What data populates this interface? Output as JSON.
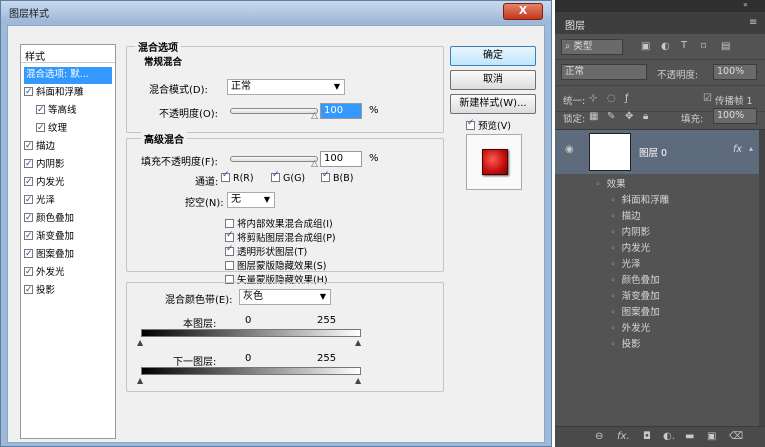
{
  "dialog": {
    "title": "图层样式",
    "close_label": "X"
  },
  "styles": {
    "header": "样式",
    "selected": "混合选项: 默...",
    "items": [
      {
        "label": "斜面和浮雕",
        "checked": true
      },
      {
        "label": "等高线",
        "checked": true
      },
      {
        "label": "纹理",
        "checked": true
      },
      {
        "label": "描边",
        "checked": true
      },
      {
        "label": "内阴影",
        "checked": true
      },
      {
        "label": "内发光",
        "checked": true
      },
      {
        "label": "光泽",
        "checked": true
      },
      {
        "label": "颜色叠加",
        "checked": true
      },
      {
        "label": "渐变叠加",
        "checked": true
      },
      {
        "label": "图案叠加",
        "checked": true
      },
      {
        "label": "外发光",
        "checked": true
      },
      {
        "label": "投影",
        "checked": true
      }
    ]
  },
  "blend": {
    "group_title": "混合选项",
    "general_title": "常规混合",
    "mode_label": "混合模式(D):",
    "mode_value": "正常",
    "opacity_label": "不透明度(O):",
    "opacity_value": "100",
    "percent": "%",
    "advanced_title": "高级混合",
    "fill_label": "填充不透明度(F):",
    "fill_value": "100",
    "channels_label": "通道:",
    "channel_r": "R(R)",
    "channel_g": "G(G)",
    "channel_b": "B(B)",
    "knockout_label": "挖空(N):",
    "knockout_value": "无",
    "opt1": "将内部效果混合成组(I)",
    "opt2": "将剪贴图层混合成组(P)",
    "opt3": "透明形状图层(T)",
    "opt4": "图层蒙版隐藏效果(S)",
    "opt5": "矢量蒙版隐藏效果(H)",
    "opt1_checked": false,
    "opt2_checked": true,
    "opt3_checked": true,
    "opt4_checked": false,
    "opt5_checked": false,
    "blendif_label": "混合颜色带(E):",
    "blendif_value": "灰色",
    "this_layer_label": "本图层:",
    "this_low": "0",
    "this_high": "255",
    "under_layer_label": "下一图层:",
    "under_low": "0",
    "under_high": "255"
  },
  "buttons": {
    "ok": "确定",
    "cancel": "取消",
    "new_style": "新建样式(W)...",
    "preview": "预览(V)"
  },
  "layers_panel": {
    "tab": "图层",
    "kind": "类型",
    "mode": "正常",
    "opacity_label": "不透明度:",
    "opacity_value": "100%",
    "unify_label": "统一:",
    "propagate_label": "传播帧 1",
    "lock_label": "锁定:",
    "fill_label": "填充:",
    "fill_value": "100%",
    "layer_name": "图层 0",
    "fx": "fx",
    "effects_label": "效果",
    "effects": [
      "斜面和浮雕",
      "描边",
      "内阴影",
      "内发光",
      "光泽",
      "颜色叠加",
      "渐变叠加",
      "图案叠加",
      "外发光",
      "投影"
    ]
  }
}
